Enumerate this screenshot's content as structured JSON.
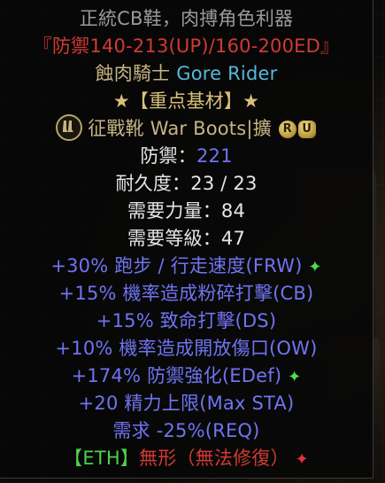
{
  "tooltip": {
    "header": "正統CB鞋，肉搏角色利器",
    "affix_note": "『防禦140-213(UP)/160-200ED』",
    "unique_name": "蝕肉騎士",
    "unique_name_en": "Gore Rider",
    "base_tag": "★【重点基材】★",
    "base_type": "征戰靴 War Boots",
    "base_sep": "|擴",
    "rune_r": "R",
    "rune_u": "U",
    "defense_label": "防禦：",
    "defense_value": "221",
    "durability": "耐久度：23 / 23",
    "req_str": "需要力量：84",
    "req_level": "需要等級：47",
    "mods": [
      "+30% 跑步 / 行走速度(FRW)",
      "+15% 機率造成粉碎打擊(CB)",
      "+15% 致命打擊(DS)",
      "+10% 機率造成開放傷口(OW)",
      "+174% 防禦強化(EDef)",
      "+20 精力上限(Max STA)",
      "需求 -25%(REQ)"
    ],
    "eth_tag": "【ETH】",
    "eth_text": "無形（無法修復）",
    "star_symbol": "✦"
  },
  "colors": {
    "header": "#9a9a9a",
    "red": "#d03a35",
    "gold": "#c6b483",
    "magic_blue": "#6f74f0",
    "unique_cyan": "#56b9d8",
    "green": "#4cd04a"
  },
  "icons": {
    "boots_type": "boots-type-icon",
    "green_star": "green-star-icon",
    "red_star": "red-star-icon"
  }
}
